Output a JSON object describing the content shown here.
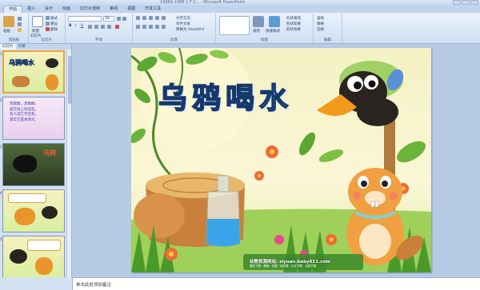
{
  "window": {
    "title": "1988A 1988 1 F 1... - Microsoft PowerPoint"
  },
  "ribbon": {
    "tabs": [
      {
        "label": "开始",
        "active": true
      },
      {
        "label": "插入",
        "active": false
      },
      {
        "label": "设计",
        "active": false
      },
      {
        "label": "动画",
        "active": false
      },
      {
        "label": "幻灯片放映",
        "active": false
      },
      {
        "label": "审阅",
        "active": false
      },
      {
        "label": "视图",
        "active": false
      },
      {
        "label": "开发工具",
        "active": false
      }
    ],
    "groups": {
      "clipboard": {
        "label": "剪贴板",
        "paste": "粘贴",
        "cut": "剪切",
        "copy": "复制",
        "format_painter": "格式刷"
      },
      "slides": {
        "label": "幻灯片",
        "new_slide": "新建",
        "layout": "版式",
        "reset": "重设",
        "delete": "删除",
        "new_slide_sub": "幻灯片"
      },
      "font": {
        "label": "字体",
        "font_value": "",
        "size_value": "18"
      },
      "paragraph": {
        "label": "段落",
        "text_direction": "文字方向",
        "align_text": "对齐文本",
        "smartart": "转换为 SmartArt"
      },
      "drawing": {
        "label": "绘图",
        "arrange": "排列",
        "quick_styles": "快速样式",
        "shape_fill": "形状填充",
        "shape_outline": "形状轮廓",
        "shape_effects": "形状效果"
      },
      "editing": {
        "label": "编辑",
        "find": "查找",
        "replace": "替换",
        "select": "选择"
      }
    }
  },
  "left_pane": {
    "tabs": [
      "幻灯片",
      "大纲"
    ],
    "slides": [
      {
        "num": "1",
        "selected": true
      },
      {
        "num": "2",
        "selected": false,
        "text_lines": [
          "黑黝黝，黑黝黝，",
          "爱在树上叫哇哇，",
          "有人说它不吉利，",
          "其实它是本领大。"
        ]
      },
      {
        "num": "3",
        "selected": false,
        "caption": "乌鸦"
      },
      {
        "num": "4",
        "selected": false
      },
      {
        "num": "5",
        "selected": false
      }
    ]
  },
  "slide": {
    "title": "乌鸦喝水",
    "footer": "幼教资源网站: ziyuan.baby611.com",
    "footer_sub": "课件下载 · 教案 · 说课 · 优质课 · 论文下载 · 试卷下载"
  },
  "notes": {
    "placeholder": "单击此处添加备注"
  },
  "colors": {
    "ribbon_bg": "#dfeaf7",
    "accent": "#3a8fe0",
    "title_outline": "#17386b",
    "selection": "#e7a63a"
  }
}
